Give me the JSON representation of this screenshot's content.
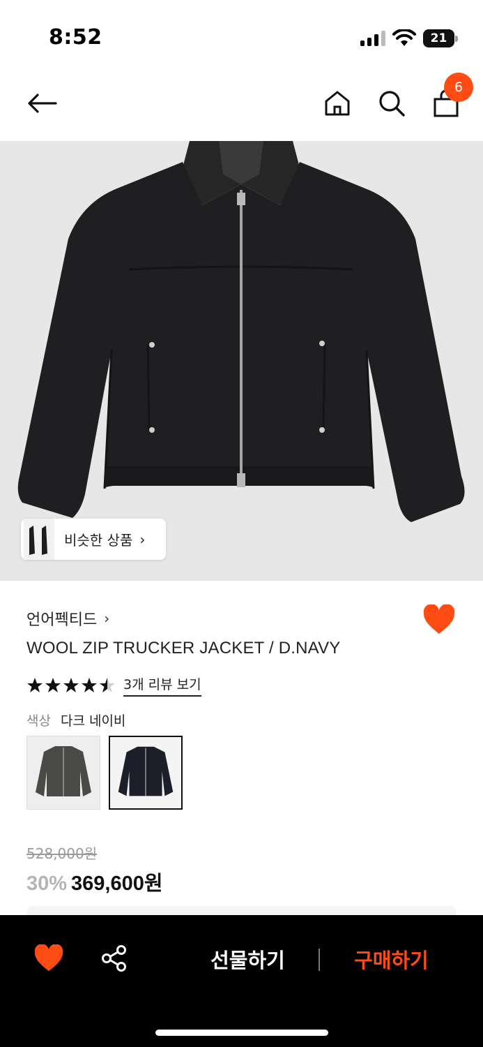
{
  "status_bar": {
    "time": "8:52",
    "battery": "21"
  },
  "header": {
    "back_icon": "arrow-left-icon",
    "home_icon": "home-icon",
    "search_icon": "search-icon",
    "cart_icon": "shopping-bag-icon",
    "cart_count": "6"
  },
  "hero": {
    "image": "dark-wool-zip-jacket",
    "similar_label": "비슷한 상품",
    "similar_chevron": "›"
  },
  "product": {
    "brand": "언어펙티드",
    "brand_chevron": "›",
    "title": "WOOL ZIP TRUCKER JACKET / D.NAVY",
    "rating": 4.5,
    "review_link": "3개 리뷰 보기",
    "color_key": "색상",
    "color_value": "다크 네이비",
    "original_price": "528,000원",
    "discount": "30%",
    "sale_price": "369,600원",
    "wishlisted": true
  },
  "bottom_bar": {
    "gift_label": "선물하기",
    "buy_label": "구매하기",
    "heart_icon": "heart-icon",
    "share_icon": "share-icon"
  },
  "colors": {
    "accent": "#ff4b14",
    "bar": "#000000"
  }
}
